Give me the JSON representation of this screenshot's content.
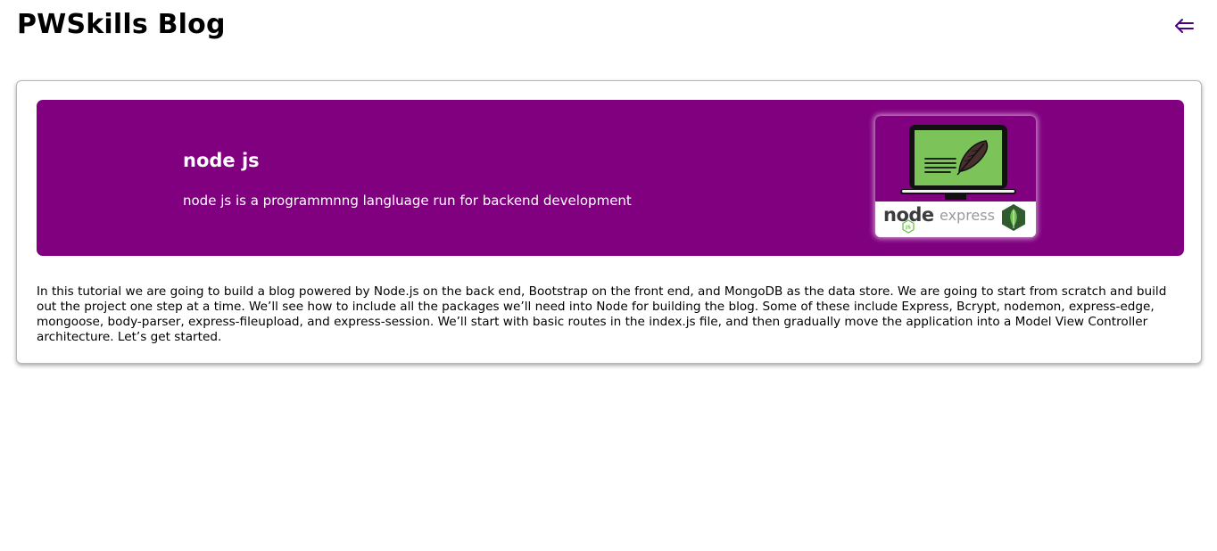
{
  "header": {
    "title": "PWSkills Blog",
    "back_icon": "left-double-arrow-icon",
    "accent": "#4b0082"
  },
  "post": {
    "title": "node js",
    "description": "node js is a programmnng langluage run for backend development",
    "banner_color": "#800080",
    "thumbnail": {
      "icon": "laptop-feather-icon",
      "logo_node": "node",
      "logo_node_badge": "JS",
      "logo_express": "express",
      "logo_mongodb_icon": "mongodb-leaf-icon"
    },
    "body": "In this tutorial we are going to build a blog powered by Node.js on the back end, Bootstrap on the front end, and MongoDB as the data store. We are going to start from scratch and build out the project one step at a time. We’ll see how to include all the packages we’ll need into Node for building the blog. Some of these include Express, Bcrypt, nodemon, express-edge, mongoose, body-parser, express-fileupload, and express-session. We’ll start with basic routes in the index.js file, and then gradually move the application into a Model View Controller architecture. Let’s get started."
  }
}
